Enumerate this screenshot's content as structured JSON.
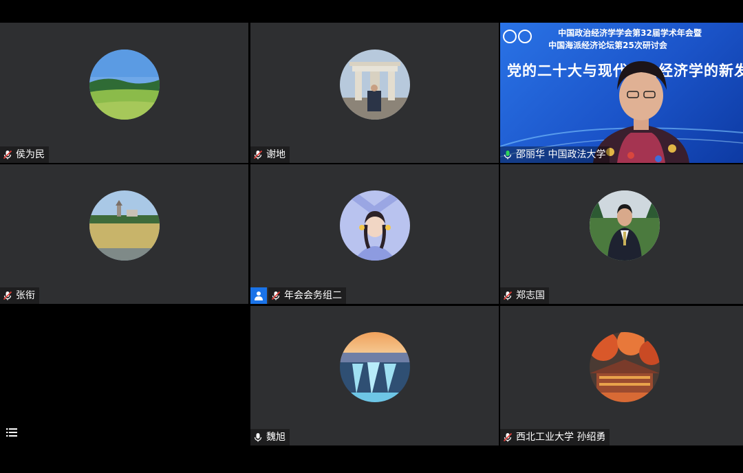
{
  "participants": [
    {
      "name": "侯为民",
      "mic": "muted",
      "avatar": "green-hills-photo"
    },
    {
      "name": "谢地",
      "mic": "muted",
      "avatar": "stone-gate-portrait"
    },
    {
      "name": "邵丽华 中国政法大学",
      "mic": "active",
      "video": "presenter-camera"
    },
    {
      "name": "张衔",
      "mic": "muted",
      "avatar": "countryside-castle-photo"
    },
    {
      "name": "年会会务组二",
      "mic": "muted",
      "avatar": "anime-girl-illustration",
      "host_badge": "user-icon"
    },
    {
      "name": "郑志国",
      "mic": "muted",
      "avatar": "suited-man-portrait"
    },
    {
      "name": "魏旭",
      "mic": "unmuted",
      "avatar": "waterfall-sunset-photo"
    },
    {
      "name": "西北工业大学  孙绍勇",
      "mic": "muted",
      "avatar": "autumn-pavilion-photo"
    }
  ],
  "slide": {
    "line1": "中国政治经济学学会第32届学术年会暨",
    "line2": "中国海派经济论坛第25次研讨会",
    "title": "党的二十大与现代政治经济学的新发展"
  },
  "colors": {
    "tile_bg": "#2e2f31",
    "active_speaker": "#2fd35a",
    "muted_red": "#e0403b",
    "badge_blue": "#1a73e8",
    "slide_blue": "#1f5fd6"
  },
  "controls": {
    "menu_icon": "list-menu-icon"
  }
}
